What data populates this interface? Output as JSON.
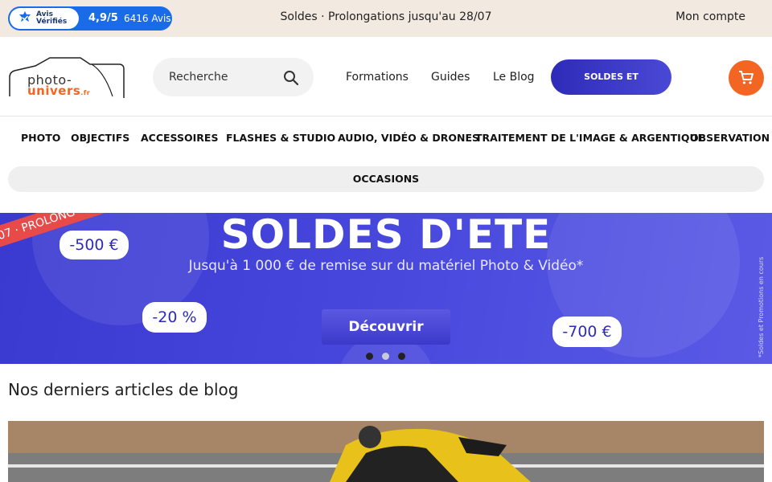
{
  "topbar": {
    "avis_brand_line1": "Avis",
    "avis_brand_line2": "Vérifiés",
    "avis_score": "4,9/5",
    "avis_count": "6416 Avis",
    "promo_text": "Soldes · Prolongations jusqu'au 28/07",
    "account_label": "Mon compte"
  },
  "header": {
    "logo_word1": "photo-",
    "logo_word2": "univers",
    "logo_tld": ".fr",
    "search_placeholder": "Recherche",
    "nav": [
      "Formations",
      "Guides",
      "Le Blog"
    ],
    "soldes_button": "SOLDES ET PROMOTIONS"
  },
  "categories": [
    "PHOTO",
    "OBJECTIFS",
    "ACCESSOIRES",
    "FLASHES & STUDIO",
    "AUDIO, VIDÉO & DRONES",
    "TRAITEMENT DE L'IMAGE & ARGENTIQUE",
    "OBSERVATION"
  ],
  "occasions_label": "OCCASIONS",
  "banner": {
    "ribbon_text": "/07 · PROLONG",
    "title": "SOLDES D'ETE",
    "subtitle": "Jusqu'à 1 000 € de remise sur du matériel Photo & Vidéo*",
    "badge_1": "-500 €",
    "badge_2": "-20 %",
    "badge_3": "-700 €",
    "cta_label": "Découvrir",
    "footnote": "*Soldes et Promotions en cours",
    "active_slide": 2,
    "slide_count": 3
  },
  "blog": {
    "section_title": "Nos derniers articles de blog"
  },
  "colors": {
    "brand_orange": "#f26522",
    "brand_blue": "#2d2bb8",
    "topbar_bg": "#f2e9e1",
    "avis_blue": "#1a6be8"
  }
}
